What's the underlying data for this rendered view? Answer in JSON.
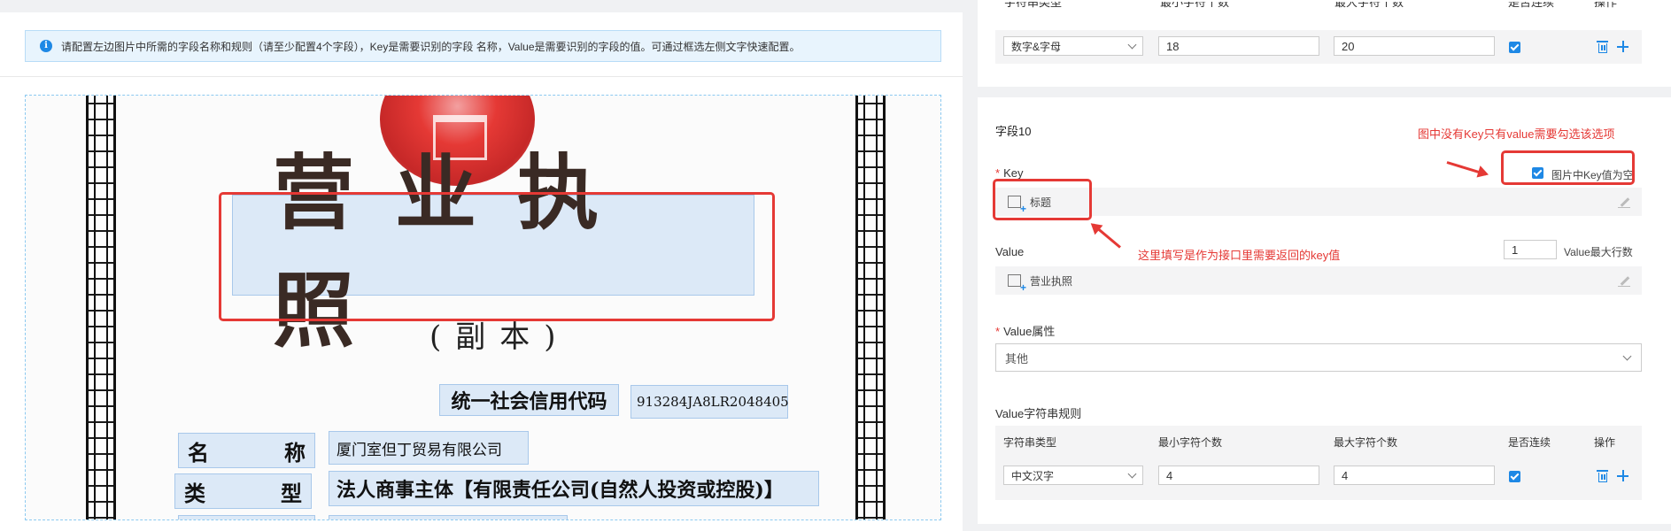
{
  "notice": {
    "icon": "info-icon",
    "text": "请配置左边图片中所需的字段名称和规则（请至少配置4个字段），Key是需要识别的字段 名称，Value是需要识别的字段的值。可通过框选左侧文字快速配置。"
  },
  "document": {
    "title": "营业执照",
    "subtitle": "(副本)",
    "credit_label": "统一社会信用代码",
    "credit_value": "913284JA8LR2048405",
    "rows": [
      {
        "label_left": "名",
        "label_right": "称",
        "value": "厦门室但丁贸易有限公司"
      },
      {
        "label_left": "类",
        "label_right": "型",
        "value": "法人商事主体【有限责任公司(自然人投资或控股)】"
      }
    ]
  },
  "prev_field": {
    "char_type": "数字&字母",
    "min_chars": "18",
    "max_chars": "20",
    "continuous_checked": true
  },
  "field": {
    "title": "字段10",
    "key_label": "Key",
    "key_empty_label": "图片中Key值为空",
    "key_empty_checked": true,
    "key_value": "标题",
    "value_label": "Value",
    "value_max_lines": "1",
    "value_max_lines_label": "Value最大行数",
    "value_value": "营业执照",
    "attr_label": "Value属性",
    "attr_selected": "其他",
    "rule_label": "Value字符串规则",
    "rule_headers": [
      "字符串类型",
      "最小字符个数",
      "最大字符个数",
      "是否连续",
      "操作"
    ],
    "rule_row": {
      "char_type": "中文汉字",
      "min_chars": "4",
      "max_chars": "4",
      "continuous_checked": true
    }
  },
  "annotations": {
    "top_right": "图中没有Key只有value需要勾选该选项",
    "key_note": "这里填写是作为接口里需要返回的key值"
  },
  "colors": {
    "accent": "#1e88e5",
    "annotation_red": "#e53935",
    "highlight": "#dce9f7"
  }
}
